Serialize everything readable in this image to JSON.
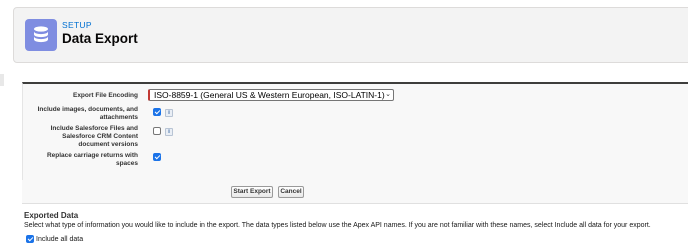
{
  "header": {
    "eyebrow": "SETUP",
    "title": "Data Export",
    "icon": "database-icon",
    "icon_color": "#7f8de1"
  },
  "form": {
    "encoding_label": "Export File Encoding",
    "encoding_value": "ISO-8859-1 (General US & Western European, ISO-LATIN-1)",
    "include_images_label_1": "Include images, documents, and",
    "include_images_label_2": "attachments",
    "include_images_checked": true,
    "include_files_label_1": "Include Salesforce Files and",
    "include_files_label_2": "Salesforce CRM Content",
    "include_files_label_3": "document versions",
    "include_files_checked": false,
    "replace_cr_label_1": "Replace carriage returns with",
    "replace_cr_label_2": "spaces",
    "replace_cr_checked": true,
    "info_glyph": "i"
  },
  "buttons": {
    "start_export": "Start Export",
    "cancel": "Cancel"
  },
  "exported_data": {
    "title": "Exported Data",
    "description": "Select what type of information you would like to include in the export. The data types listed below use the Apex API names. If you are not familiar with these names, select Include all data for your export.",
    "include_all_label": "Include all data",
    "include_all_checked": true
  }
}
